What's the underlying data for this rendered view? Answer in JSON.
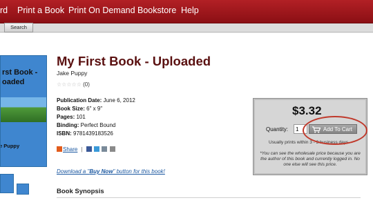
{
  "nav": {
    "items": [
      "rd",
      "Print a Book",
      "Print On Demand",
      "Bookstore",
      "Help"
    ],
    "search_label": "Search"
  },
  "book": {
    "title": "My First Book - Uploaded",
    "author": "Jake Puppy",
    "rating_count": "(0)",
    "stars": "☆☆☆☆☆",
    "rating_value": 0,
    "cover": {
      "line1": "rst Book -",
      "line2": "oaded",
      "author": "e Puppy"
    },
    "details": {
      "pub_date_label": "Publication Date:",
      "pub_date": "June 6, 2012",
      "size_label": "Book Size:",
      "size": "6\" x 9\"",
      "pages_label": "Pages:",
      "pages": "101",
      "binding_label": "Binding:",
      "binding": "Perfect Bound",
      "isbn_label": "ISBN:",
      "isbn": "9781439183526"
    }
  },
  "share": {
    "label": "Share"
  },
  "download": {
    "prefix": "Download a \"",
    "buy_now": "Buy Now",
    "suffix": "\" button for this book!"
  },
  "synopsis": {
    "heading": "Book Synopsis"
  },
  "buybox": {
    "price": "$3.32",
    "quantity_label": "Quantity:",
    "quantity_value": "1",
    "add_to_cart": "Add To Cart",
    "usually": "Usually prints within 3 - 3 business days",
    "note": "*You can see the wholesale price because you are the author of this book and currently logged in. No one else will see this price."
  },
  "colors": {
    "nav_bg": "#a8161c",
    "title": "#5a1010",
    "link": "#1a57a0",
    "highlight_oval": "#c0392b"
  }
}
